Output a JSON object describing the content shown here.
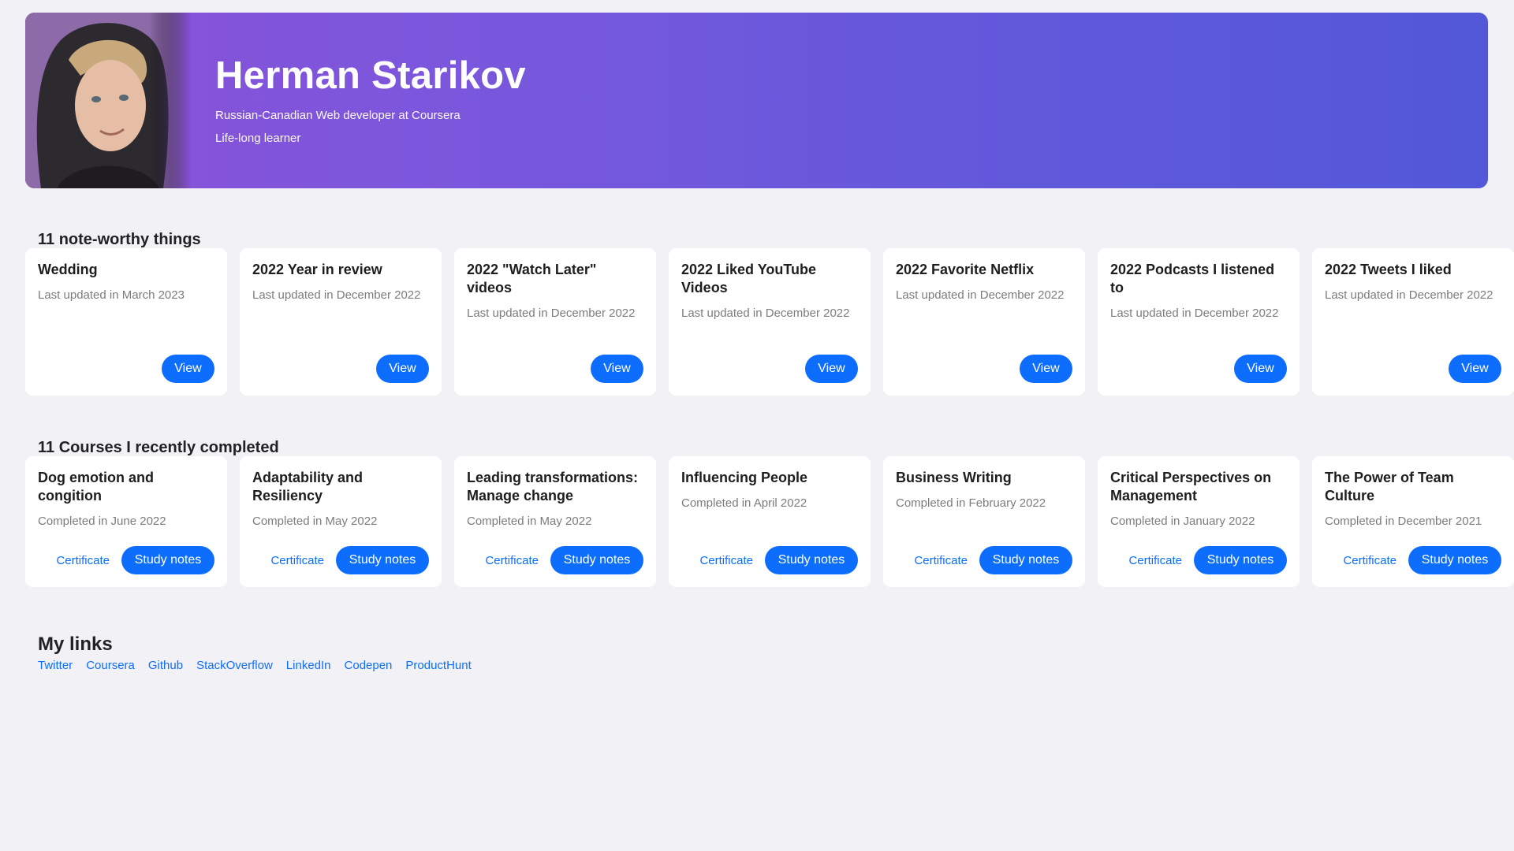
{
  "hero": {
    "name": "Herman Starikov",
    "subtitle": "Russian-Canadian Web developer at Coursera",
    "tagline": "Life-long learner",
    "photo_icon": "profile-photo",
    "gradient_start": "#8a52d9",
    "gradient_end": "#5258d8"
  },
  "notes": {
    "title": "11 note-worthy things",
    "items": [
      {
        "title": "Wedding",
        "meta": "Last updated in March 2023",
        "button": "View"
      },
      {
        "title": "2022 Year in review",
        "meta": "Last updated in December 2022",
        "button": "View"
      },
      {
        "title": "2022 \"Watch Later\" videos",
        "meta": "Last updated in December 2022",
        "button": "View"
      },
      {
        "title": "2022 Liked YouTube Videos",
        "meta": "Last updated in December 2022",
        "button": "View"
      },
      {
        "title": "2022 Favorite Netflix",
        "meta": "Last updated in December 2022",
        "button": "View"
      },
      {
        "title": "2022 Podcasts I listened to",
        "meta": "Last updated in December 2022",
        "button": "View"
      },
      {
        "title": "2022 Tweets I liked",
        "meta": "Last updated in December 2022",
        "button": "View"
      }
    ]
  },
  "courses": {
    "title": "11 Courses I recently completed",
    "items": [
      {
        "title": "Dog emotion and congition",
        "meta": "Completed in June 2022",
        "certificate": "Certificate",
        "notes": "Study notes"
      },
      {
        "title": "Adaptability and Resiliency",
        "meta": "Completed in May 2022",
        "certificate": "Certificate",
        "notes": "Study notes"
      },
      {
        "title": "Leading transformations: Manage change",
        "meta": "Completed in May 2022",
        "certificate": "Certificate",
        "notes": "Study notes"
      },
      {
        "title": "Influencing People",
        "meta": "Completed in April 2022",
        "certificate": "Certificate",
        "notes": "Study notes"
      },
      {
        "title": "Business Writing",
        "meta": "Completed in February 2022",
        "certificate": "Certificate",
        "notes": "Study notes"
      },
      {
        "title": "Critical Perspectives on Management",
        "meta": "Completed in January 2022",
        "certificate": "Certificate",
        "notes": "Study notes"
      },
      {
        "title": "The Power of Team Culture",
        "meta": "Completed in December 2021",
        "certificate": "Certificate",
        "notes": "Study notes"
      }
    ]
  },
  "links": {
    "title": "My links",
    "items": [
      "Twitter",
      "Coursera",
      "Github",
      "StackOverflow",
      "LinkedIn",
      "Codepen",
      "ProductHunt"
    ]
  },
  "colors": {
    "accent": "#0d6efd",
    "background": "#f2f1f6",
    "card": "#ffffff",
    "muted_text": "#7c7c7c"
  }
}
